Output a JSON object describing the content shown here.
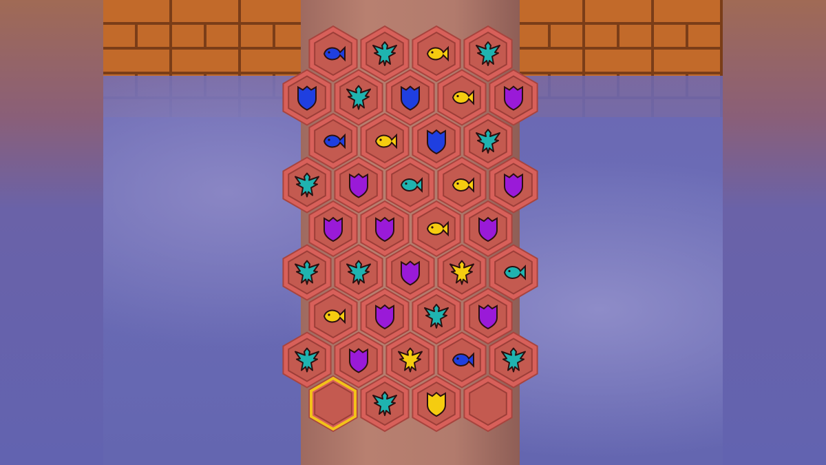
{
  "game": {
    "board": {
      "rows": [
        [
          "blue-fish",
          "teal-bird",
          "yellow-fish",
          "teal-bird"
        ],
        [
          "blue-shield",
          "teal-bird",
          "blue-shield",
          "yellow-fish",
          "purple-shield"
        ],
        [
          "blue-fish",
          "yellow-fish",
          "blue-shield",
          "teal-bird"
        ],
        [
          "teal-bird",
          "purple-shield",
          "teal-fish",
          "yellow-fish",
          "purple-shield"
        ],
        [
          "purple-shield",
          "purple-shield",
          "yellow-fish",
          "purple-shield"
        ],
        [
          "teal-bird",
          "teal-bird",
          "purple-shield",
          "yellow-bird",
          "teal-fish"
        ],
        [
          "yellow-fish",
          "purple-shield",
          "teal-bird",
          "purple-shield"
        ],
        [
          "teal-bird",
          "purple-shield",
          "yellow-bird",
          "blue-fish",
          "teal-bird"
        ],
        [
          "empty",
          "teal-bird",
          "yellow-shield",
          "empty"
        ]
      ],
      "selected": {
        "row": 8,
        "col": 0
      }
    },
    "colors": {
      "blue": "#1f3fe0",
      "teal": "#1fb3b0",
      "yellow": "#f5cc10",
      "purple": "#9a1ad8",
      "hex_rim": "#d8605a",
      "hex_inner": "#c45a50",
      "selection": "#f2c21a"
    }
  }
}
